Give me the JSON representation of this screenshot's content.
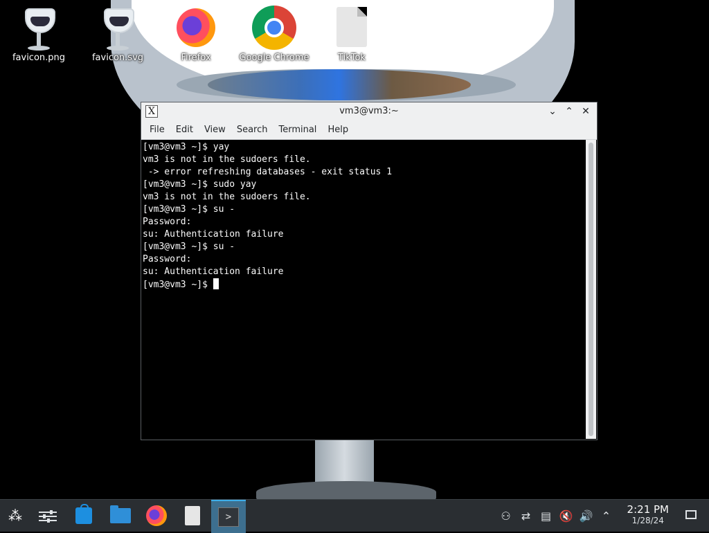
{
  "desktop": {
    "icons": [
      {
        "label": "favicon.png",
        "icon": "goblet-image-icon"
      },
      {
        "label": "favicon.svg",
        "icon": "goblet-image-icon"
      },
      {
        "label": "Firefox",
        "icon": "firefox-icon"
      },
      {
        "label": "Google Chrome",
        "icon": "chrome-icon"
      },
      {
        "label": "TikTok",
        "icon": "file-icon"
      }
    ]
  },
  "window": {
    "title": "vm3@vm3:~",
    "app_icon": "x11-icon",
    "app_icon_glyph": "X",
    "controls": {
      "minimize": "⌄",
      "maximize": "⌃",
      "close": "✕"
    },
    "menu": [
      "File",
      "Edit",
      "View",
      "Search",
      "Terminal",
      "Help"
    ]
  },
  "terminal": {
    "lines": [
      "[vm3@vm3 ~]$ yay",
      "vm3 is not in the sudoers file.",
      " -> error refreshing databases - exit status 1",
      "[vm3@vm3 ~]$ sudo yay",
      "vm3 is not in the sudoers file.",
      "[vm3@vm3 ~]$ su -",
      "Password:",
      "su: Authentication failure",
      "[vm3@vm3 ~]$ su -",
      "Password:",
      "su: Authentication failure"
    ],
    "prompt": "[vm3@vm3 ~]$ "
  },
  "taskbar": {
    "launcher_glyph": "⁂",
    "terminal_glyph": ">",
    "items": [
      "application-launcher-icon",
      "system-settings-icon",
      "discover-store-icon",
      "dolphin-folder-icon",
      "firefox-icon",
      "file-icon",
      "konsole-terminal-icon"
    ],
    "tray": [
      {
        "icon": "user-icon",
        "glyph": "⚇"
      },
      {
        "icon": "network-icon",
        "glyph": "⇄"
      },
      {
        "icon": "clipboard-icon",
        "glyph": "▤"
      },
      {
        "icon": "muted-speaker-icon",
        "glyph": "🔇"
      },
      {
        "icon": "volume-icon",
        "glyph": "🔊"
      },
      {
        "icon": "tray-expand-icon",
        "glyph": "⌃"
      }
    ],
    "clock": {
      "time": "2:21 PM",
      "date": "1/28/24"
    }
  }
}
